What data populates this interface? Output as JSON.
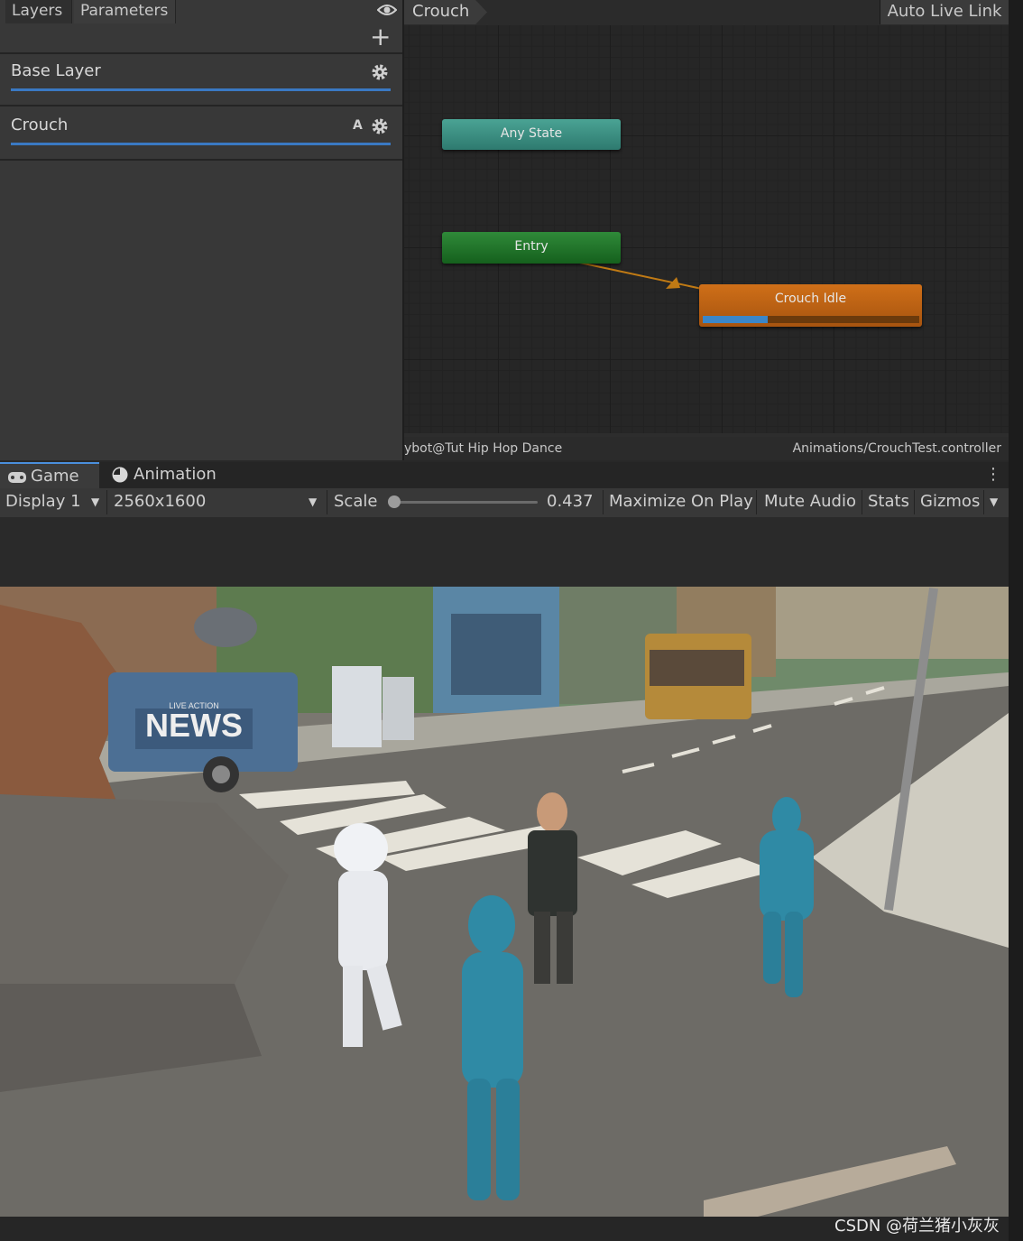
{
  "layers_panel": {
    "tabs": [
      "Layers",
      "Parameters"
    ],
    "layers": [
      {
        "name": "Base Layer"
      },
      {
        "name": "Crouch",
        "badge": "A"
      }
    ]
  },
  "graph": {
    "breadcrumb": "Crouch",
    "auto_live_link": "Auto Live Link",
    "nodes": {
      "any_state": "Any State",
      "entry": "Entry",
      "crouch_idle": "Crouch Idle"
    },
    "crouch_idle_progress": 0.3,
    "status_left": "ybot@Tut Hip Hop Dance",
    "status_right": "Animations/CrouchTest.controller"
  },
  "game": {
    "tabs": [
      "Game",
      "Animation"
    ],
    "toolbar": {
      "display": "Display 1",
      "resolution": "2560x1600",
      "scale_label": "Scale",
      "scale_value": "0.437",
      "maximize": "Maximize On Play",
      "mute": "Mute Audio",
      "stats": "Stats",
      "gizmos": "Gizmos"
    },
    "scene": {
      "van_text_top": "LIVE ACTION",
      "van_text_main": "NEWS"
    }
  },
  "watermark": "CSDN @荷兰猪小灰灰",
  "colors": {
    "any_state": "#3c8f83",
    "entry": "#237a2c",
    "crouch_idle": "#c0631a",
    "accent_blue": "#3a79c3"
  }
}
